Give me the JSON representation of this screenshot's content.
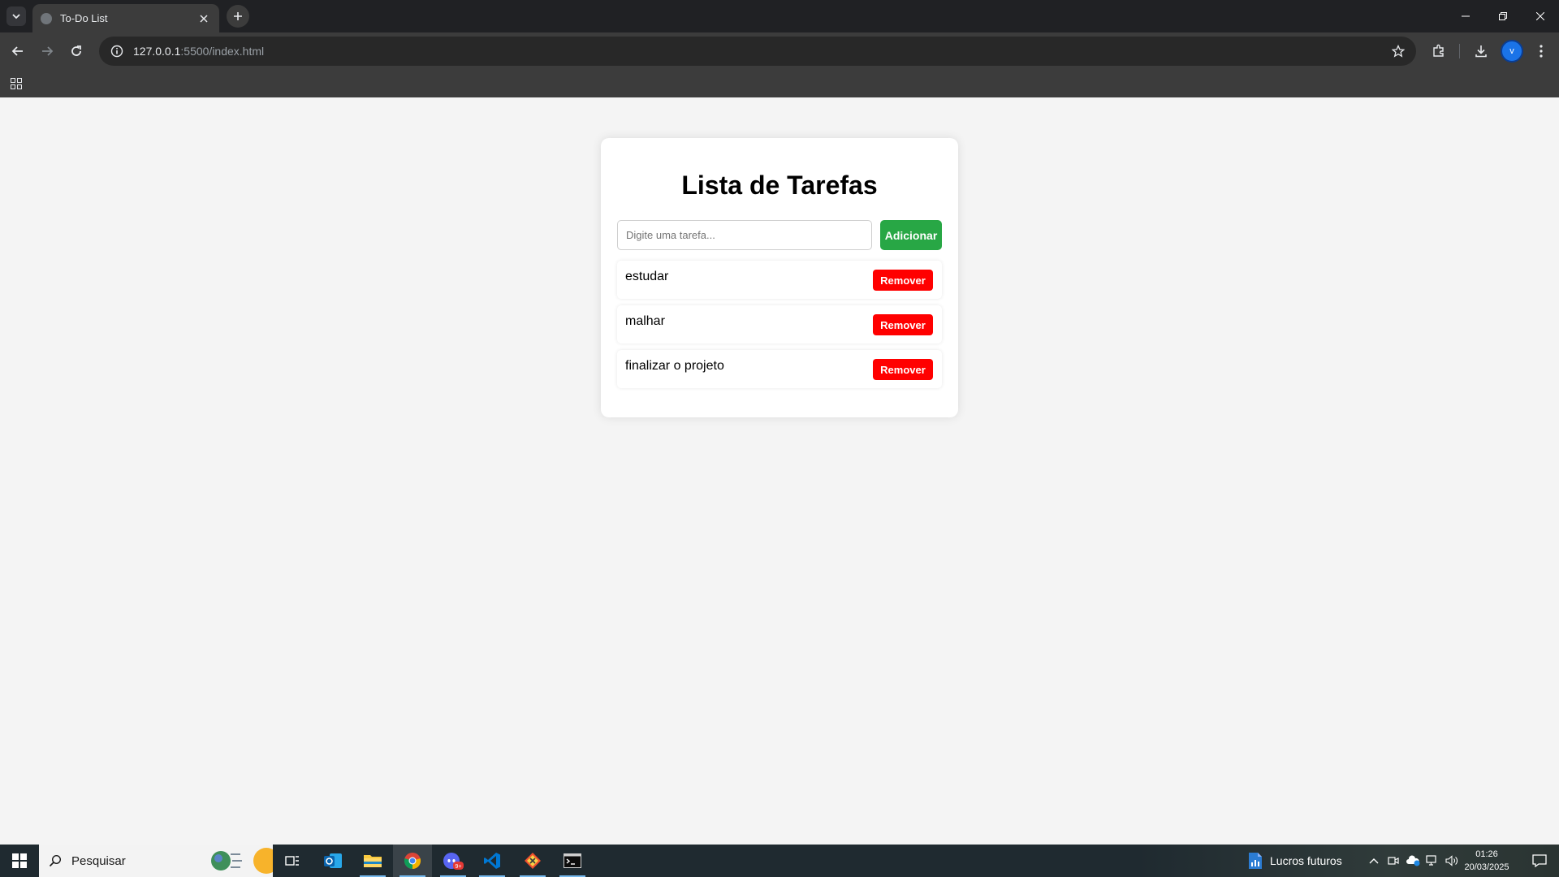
{
  "browser": {
    "tab_title": "To-Do List",
    "url_host": "127.0.0.1",
    "url_rest": ":5500/index.html",
    "avatar_letter": "v"
  },
  "page": {
    "title": "Lista de Tarefas",
    "input_placeholder": "Digite uma tarefa...",
    "input_value": "",
    "add_label": "Adicionar",
    "tasks": [
      {
        "text": "estudar",
        "remove_label": "Remover"
      },
      {
        "text": "malhar",
        "remove_label": "Remover"
      },
      {
        "text": "finalizar o projeto",
        "remove_label": "Remover"
      }
    ]
  },
  "taskbar": {
    "search_label": "Pesquisar",
    "weather_label": "Lucros futuros",
    "time": "01:26",
    "date": "20/03/2025",
    "badge": "9+"
  },
  "colors": {
    "add_button": "#28a745",
    "remove_button": "#ff0000",
    "page_bg": "#f4f4f4",
    "chrome_dark": "#202124"
  }
}
